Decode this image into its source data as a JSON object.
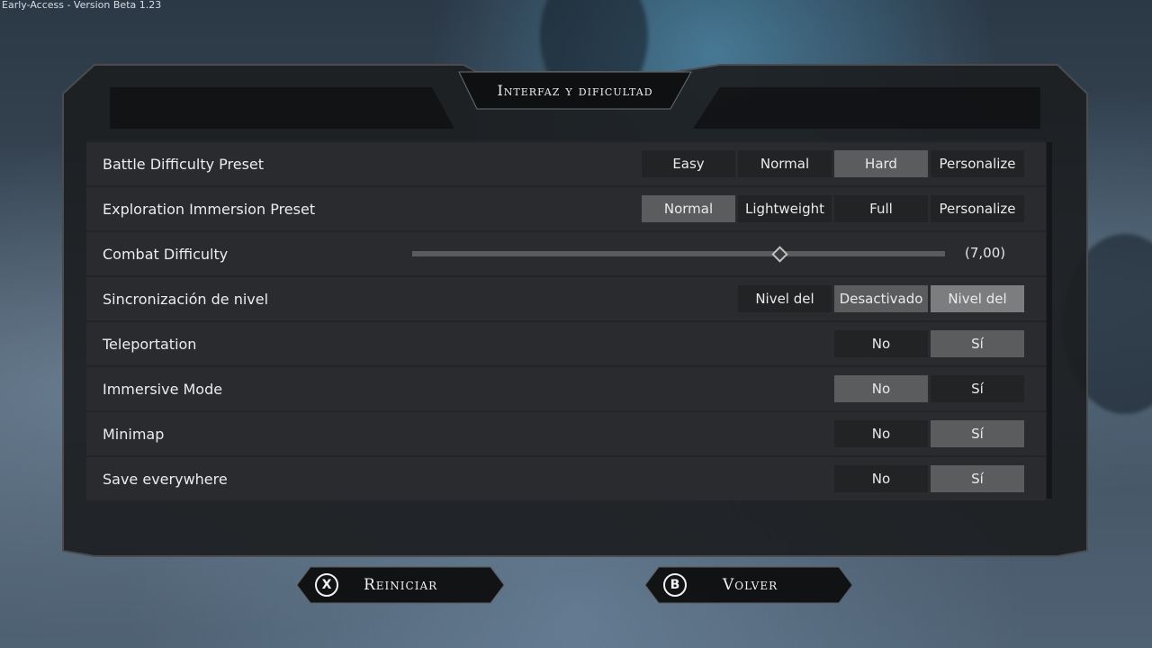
{
  "version_text": "Early-Access - Version Beta 1.23",
  "title": "Interfaz y dificultad",
  "rows": [
    {
      "label": "Battle Difficulty Preset",
      "options": [
        "Easy",
        "Normal",
        "Hard",
        "Personalize"
      ],
      "selected": "Hard"
    },
    {
      "label": "Exploration Immersion Preset",
      "options": [
        "Normal",
        "Lightweight",
        "Full",
        "Personalize"
      ],
      "selected": "Normal"
    },
    {
      "label": "Combat Difficulty",
      "slider_value_text": "(7,00)",
      "slider_fraction": 0.69
    },
    {
      "label": "Sincronización de nivel",
      "options": [
        "Nivel del",
        "Desactivado",
        "Nivel del"
      ],
      "selected": "Nivel del (2)"
    },
    {
      "label": "Teleportation",
      "options": [
        "No",
        "Sí"
      ],
      "selected": "Sí"
    },
    {
      "label": "Immersive Mode",
      "options": [
        "No",
        "Sí"
      ],
      "selected": "No"
    },
    {
      "label": "Minimap",
      "options": [
        "No",
        "Sí"
      ],
      "selected": "Sí"
    },
    {
      "label": "Save everywhere",
      "options": [
        "No",
        "Sí"
      ],
      "selected": "Sí"
    }
  ],
  "buttons": {
    "reset": {
      "icon": "X",
      "label": "Reiniciar"
    },
    "back": {
      "icon": "B",
      "label": "Volver"
    }
  }
}
